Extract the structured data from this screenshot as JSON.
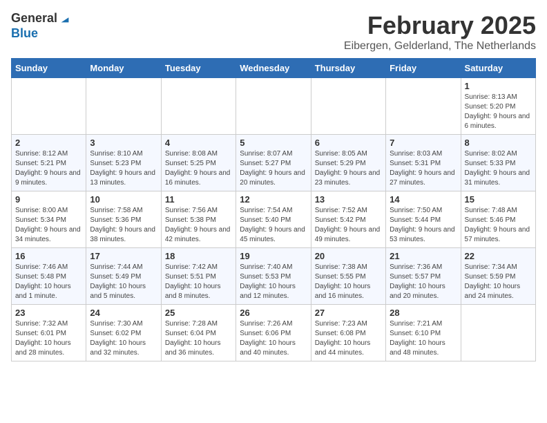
{
  "logo": {
    "line1": "General",
    "line2": "Blue"
  },
  "title": "February 2025",
  "subtitle": "Eibergen, Gelderland, The Netherlands",
  "weekdays": [
    "Sunday",
    "Monday",
    "Tuesday",
    "Wednesday",
    "Thursday",
    "Friday",
    "Saturday"
  ],
  "weeks": [
    [
      {
        "day": "",
        "info": ""
      },
      {
        "day": "",
        "info": ""
      },
      {
        "day": "",
        "info": ""
      },
      {
        "day": "",
        "info": ""
      },
      {
        "day": "",
        "info": ""
      },
      {
        "day": "",
        "info": ""
      },
      {
        "day": "1",
        "info": "Sunrise: 8:13 AM\nSunset: 5:20 PM\nDaylight: 9 hours and 6 minutes."
      }
    ],
    [
      {
        "day": "2",
        "info": "Sunrise: 8:12 AM\nSunset: 5:21 PM\nDaylight: 9 hours and 9 minutes."
      },
      {
        "day": "3",
        "info": "Sunrise: 8:10 AM\nSunset: 5:23 PM\nDaylight: 9 hours and 13 minutes."
      },
      {
        "day": "4",
        "info": "Sunrise: 8:08 AM\nSunset: 5:25 PM\nDaylight: 9 hours and 16 minutes."
      },
      {
        "day": "5",
        "info": "Sunrise: 8:07 AM\nSunset: 5:27 PM\nDaylight: 9 hours and 20 minutes."
      },
      {
        "day": "6",
        "info": "Sunrise: 8:05 AM\nSunset: 5:29 PM\nDaylight: 9 hours and 23 minutes."
      },
      {
        "day": "7",
        "info": "Sunrise: 8:03 AM\nSunset: 5:31 PM\nDaylight: 9 hours and 27 minutes."
      },
      {
        "day": "8",
        "info": "Sunrise: 8:02 AM\nSunset: 5:33 PM\nDaylight: 9 hours and 31 minutes."
      }
    ],
    [
      {
        "day": "9",
        "info": "Sunrise: 8:00 AM\nSunset: 5:34 PM\nDaylight: 9 hours and 34 minutes."
      },
      {
        "day": "10",
        "info": "Sunrise: 7:58 AM\nSunset: 5:36 PM\nDaylight: 9 hours and 38 minutes."
      },
      {
        "day": "11",
        "info": "Sunrise: 7:56 AM\nSunset: 5:38 PM\nDaylight: 9 hours and 42 minutes."
      },
      {
        "day": "12",
        "info": "Sunrise: 7:54 AM\nSunset: 5:40 PM\nDaylight: 9 hours and 45 minutes."
      },
      {
        "day": "13",
        "info": "Sunrise: 7:52 AM\nSunset: 5:42 PM\nDaylight: 9 hours and 49 minutes."
      },
      {
        "day": "14",
        "info": "Sunrise: 7:50 AM\nSunset: 5:44 PM\nDaylight: 9 hours and 53 minutes."
      },
      {
        "day": "15",
        "info": "Sunrise: 7:48 AM\nSunset: 5:46 PM\nDaylight: 9 hours and 57 minutes."
      }
    ],
    [
      {
        "day": "16",
        "info": "Sunrise: 7:46 AM\nSunset: 5:48 PM\nDaylight: 10 hours and 1 minute."
      },
      {
        "day": "17",
        "info": "Sunrise: 7:44 AM\nSunset: 5:49 PM\nDaylight: 10 hours and 5 minutes."
      },
      {
        "day": "18",
        "info": "Sunrise: 7:42 AM\nSunset: 5:51 PM\nDaylight: 10 hours and 8 minutes."
      },
      {
        "day": "19",
        "info": "Sunrise: 7:40 AM\nSunset: 5:53 PM\nDaylight: 10 hours and 12 minutes."
      },
      {
        "day": "20",
        "info": "Sunrise: 7:38 AM\nSunset: 5:55 PM\nDaylight: 10 hours and 16 minutes."
      },
      {
        "day": "21",
        "info": "Sunrise: 7:36 AM\nSunset: 5:57 PM\nDaylight: 10 hours and 20 minutes."
      },
      {
        "day": "22",
        "info": "Sunrise: 7:34 AM\nSunset: 5:59 PM\nDaylight: 10 hours and 24 minutes."
      }
    ],
    [
      {
        "day": "23",
        "info": "Sunrise: 7:32 AM\nSunset: 6:01 PM\nDaylight: 10 hours and 28 minutes."
      },
      {
        "day": "24",
        "info": "Sunrise: 7:30 AM\nSunset: 6:02 PM\nDaylight: 10 hours and 32 minutes."
      },
      {
        "day": "25",
        "info": "Sunrise: 7:28 AM\nSunset: 6:04 PM\nDaylight: 10 hours and 36 minutes."
      },
      {
        "day": "26",
        "info": "Sunrise: 7:26 AM\nSunset: 6:06 PM\nDaylight: 10 hours and 40 minutes."
      },
      {
        "day": "27",
        "info": "Sunrise: 7:23 AM\nSunset: 6:08 PM\nDaylight: 10 hours and 44 minutes."
      },
      {
        "day": "28",
        "info": "Sunrise: 7:21 AM\nSunset: 6:10 PM\nDaylight: 10 hours and 48 minutes."
      },
      {
        "day": "",
        "info": ""
      }
    ]
  ]
}
